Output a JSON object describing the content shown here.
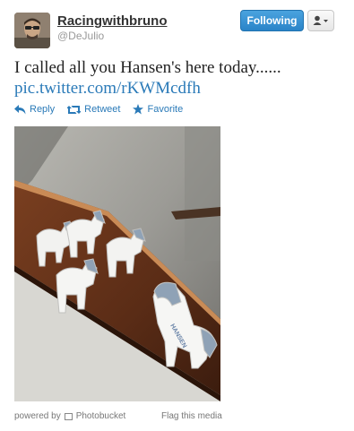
{
  "tweet": {
    "display_name": "Racingwithbruno",
    "handle": "@DeJulio",
    "follow_label": "Following",
    "text": "I called all you Hansen's here today......",
    "link": "pic.twitter.com/rKWMcdfh",
    "actions": [
      {
        "label": "Reply",
        "icon": "reply-icon"
      },
      {
        "label": "Retweet",
        "icon": "retweet-icon"
      },
      {
        "label": "Favorite",
        "icon": "star-icon"
      }
    ]
  },
  "media": {
    "figure_label": "HANSEN",
    "powered_by": "powered by",
    "provider": "Photobucket",
    "flag_label": "Flag this media"
  },
  "colors": {
    "link": "#2a7ab8",
    "follow_button": "#2a84c8"
  }
}
